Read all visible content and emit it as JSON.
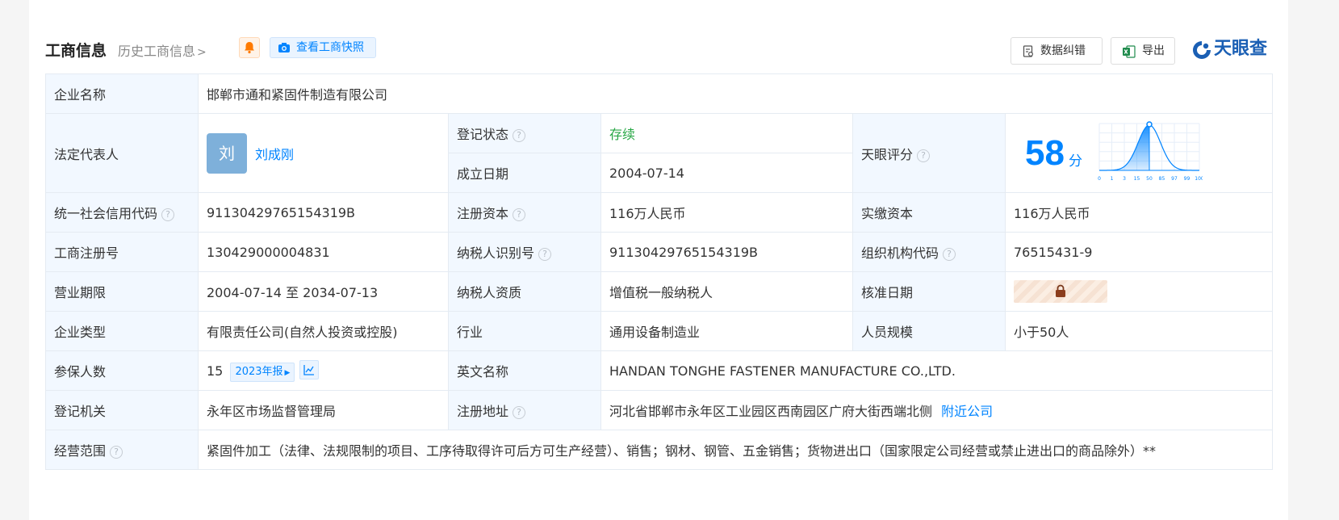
{
  "header": {
    "title": "工商信息",
    "history": "历史工商信息",
    "snapshot": "查看工商快照",
    "correction": "数据纠错",
    "export": "导出",
    "brand": "天眼查"
  },
  "rows": {
    "company_name_label": "企业名称",
    "company_name": "邯郸市通和紧固件制造有限公司",
    "legal_rep_label": "法定代表人",
    "legal_rep_avatar": "刘",
    "legal_rep": "刘成刚",
    "reg_status_label": "登记状态",
    "reg_status": "存续",
    "founded_label": "成立日期",
    "founded": "2004-07-14",
    "score_label": "天眼评分",
    "score": "58",
    "score_unit": "分",
    "credit_code_label": "统一社会信用代码",
    "credit_code": "91130429765154319B",
    "reg_capital_label": "注册资本",
    "reg_capital": "116万人民币",
    "paid_capital_label": "实缴资本",
    "paid_capital": "116万人民币",
    "biz_reg_no_label": "工商注册号",
    "biz_reg_no": "130429000004831",
    "taxpayer_id_label": "纳税人识别号",
    "taxpayer_id": "91130429765154319B",
    "org_code_label": "组织机构代码",
    "org_code": "76515431-9",
    "term_label": "营业期限",
    "term": "2004-07-14 至 2034-07-13",
    "tax_quality_label": "纳税人资质",
    "tax_quality": "增值税一般纳税人",
    "approval_date_label": "核准日期",
    "company_type_label": "企业类型",
    "company_type": "有限责任公司(自然人投资或控股)",
    "industry_label": "行业",
    "industry": "通用设备制造业",
    "staff_size_label": "人员规模",
    "staff_size": "小于50人",
    "insured_label": "参保人数",
    "insured": "15",
    "insured_report": "2023年报",
    "english_name_label": "英文名称",
    "english_name": "HANDAN TONGHE FASTENER MANUFACTURE CO.,LTD.",
    "authority_label": "登记机关",
    "authority": "永年区市场监督管理局",
    "address_label": "注册地址",
    "address": "河北省邯郸市永年区工业园区西南园区广府大街西端北侧",
    "nearby": "附近公司",
    "scope_label": "经营范围",
    "scope": "紧固件加工（法律、法规限制的项目、工序待取得许可后方可生产经营）、销售；钢材、钢管、五金销售；货物进出口（国家限定公司经营或禁止进出口的商品除外）**"
  },
  "score_chart": {
    "ticks": [
      "0",
      "1",
      "3",
      "15",
      "50",
      "85",
      "97",
      "99",
      "100"
    ],
    "marker": "50"
  },
  "colors": {
    "accent": "#0084ff",
    "status_green": "#27a745",
    "label_bg": "#f2f8ff"
  },
  "icons": {
    "bell": "bell-icon",
    "camera": "camera-icon",
    "correction": "document-edit-icon",
    "export": "excel-icon",
    "lock": "lock-icon",
    "trend": "line-chart-icon",
    "help": "question-circle-icon"
  }
}
